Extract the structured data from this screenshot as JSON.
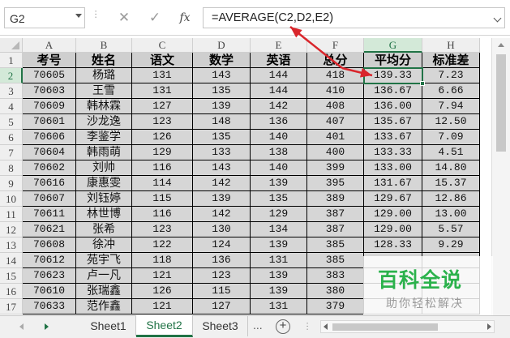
{
  "formula_bar": {
    "name_box": "G2",
    "cancel_symbol": "✕",
    "confirm_symbol": "✓",
    "fx_symbol": "fx",
    "formula": "=AVERAGE(C2,D2,E2)"
  },
  "columns": [
    "A",
    "B",
    "C",
    "D",
    "E",
    "F",
    "G",
    "H"
  ],
  "row_numbers": [
    "1",
    "2",
    "3",
    "4",
    "5",
    "6",
    "7",
    "8",
    "9",
    "10",
    "11",
    "12",
    "13",
    "14",
    "15",
    "16",
    "17"
  ],
  "selected_column": "G",
  "selected_row": "2",
  "table": {
    "headers": [
      "考号",
      "姓名",
      "语文",
      "数学",
      "英语",
      "总分",
      "平均分",
      "标准差"
    ],
    "rows": [
      [
        "70605",
        "杨璐",
        "131",
        "143",
        "144",
        "418",
        "139.33",
        "7.23"
      ],
      [
        "70603",
        "王雪",
        "131",
        "135",
        "144",
        "410",
        "136.67",
        "6.66"
      ],
      [
        "70609",
        "韩林霖",
        "127",
        "139",
        "142",
        "408",
        "136.00",
        "7.94"
      ],
      [
        "70601",
        "沙龙逸",
        "123",
        "148",
        "136",
        "407",
        "135.67",
        "12.50"
      ],
      [
        "70606",
        "李鉴学",
        "126",
        "135",
        "140",
        "401",
        "133.67",
        "7.09"
      ],
      [
        "70604",
        "韩雨萌",
        "129",
        "133",
        "138",
        "400",
        "133.33",
        "4.51"
      ],
      [
        "70602",
        "刘帅",
        "116",
        "143",
        "140",
        "399",
        "133.00",
        "14.80"
      ],
      [
        "70616",
        "康惠雯",
        "114",
        "142",
        "139",
        "395",
        "131.67",
        "15.37"
      ],
      [
        "70607",
        "刘钰婷",
        "115",
        "139",
        "135",
        "389",
        "129.67",
        "12.86"
      ],
      [
        "70611",
        "林世博",
        "116",
        "142",
        "129",
        "387",
        "129.00",
        "13.00"
      ],
      [
        "70621",
        "张希",
        "123",
        "130",
        "134",
        "387",
        "129.00",
        "5.57"
      ],
      [
        "70608",
        "徐冲",
        "122",
        "124",
        "139",
        "385",
        "128.33",
        "9.29"
      ],
      [
        "70612",
        "苑宇飞",
        "118",
        "136",
        "131",
        "385",
        "",
        ""
      ],
      [
        "70623",
        "卢一凡",
        "121",
        "123",
        "139",
        "383",
        "",
        ""
      ],
      [
        "70610",
        "张瑞鑫",
        "126",
        "115",
        "139",
        "380",
        "",
        ""
      ],
      [
        "70633",
        "范作鑫",
        "121",
        "127",
        "131",
        "379",
        "",
        ""
      ]
    ]
  },
  "sheet_tabs": [
    "Sheet1",
    "Sheet2",
    "Sheet3"
  ],
  "active_sheet": "Sheet2",
  "tab_more": "...",
  "tab_add": "+",
  "watermark": {
    "title": "百科全说",
    "subtitle": "助你轻松解决"
  },
  "colors": {
    "excel_green": "#217346",
    "arrow_red": "#d9262c",
    "watermark_green": "#2bb24c"
  }
}
